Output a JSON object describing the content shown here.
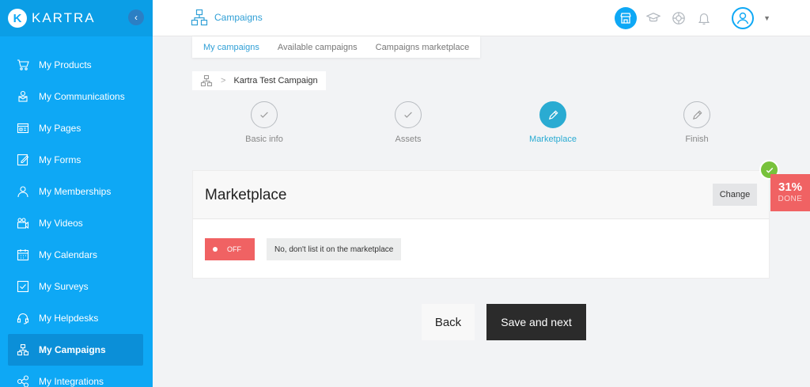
{
  "brand": {
    "name": "KARTRA",
    "mark": "K"
  },
  "sidebar": {
    "items": [
      {
        "label": "My Products",
        "icon": "cart-icon"
      },
      {
        "label": "My Communications",
        "icon": "communications-icon"
      },
      {
        "label": "My Pages",
        "icon": "pages-icon"
      },
      {
        "label": "My Forms",
        "icon": "forms-icon"
      },
      {
        "label": "My Memberships",
        "icon": "memberships-icon"
      },
      {
        "label": "My Videos",
        "icon": "videos-icon"
      },
      {
        "label": "My Calendars",
        "icon": "calendar-icon"
      },
      {
        "label": "My Surveys",
        "icon": "surveys-icon"
      },
      {
        "label": "My Helpdesks",
        "icon": "headset-icon"
      },
      {
        "label": "My Campaigns",
        "icon": "campaigns-icon",
        "active": true
      },
      {
        "label": "My Integrations",
        "icon": "integrations-icon"
      }
    ]
  },
  "header": {
    "title": "Campaigns"
  },
  "subtabs": [
    "My campaigns",
    "Available campaigns",
    "Campaigns marketplace"
  ],
  "breadcrumb": {
    "current": "Kartra Test Campaign"
  },
  "steps": [
    {
      "label": "Basic info",
      "state": "done"
    },
    {
      "label": "Assets",
      "state": "done"
    },
    {
      "label": "Marketplace",
      "state": "active"
    },
    {
      "label": "Finish",
      "state": "pending"
    }
  ],
  "card": {
    "title": "Marketplace",
    "change_label": "Change",
    "toggle_label": "OFF",
    "toggle_text": "No, don't list it on the marketplace"
  },
  "progress": {
    "percent": "31%",
    "label": "DONE"
  },
  "actions": {
    "back_label": "Back",
    "save_label": "Save and next"
  },
  "colors": {
    "sidebar": "#0ea8f5",
    "accent": "#2aabd2",
    "danger": "#f06263",
    "success": "#78c23b"
  }
}
